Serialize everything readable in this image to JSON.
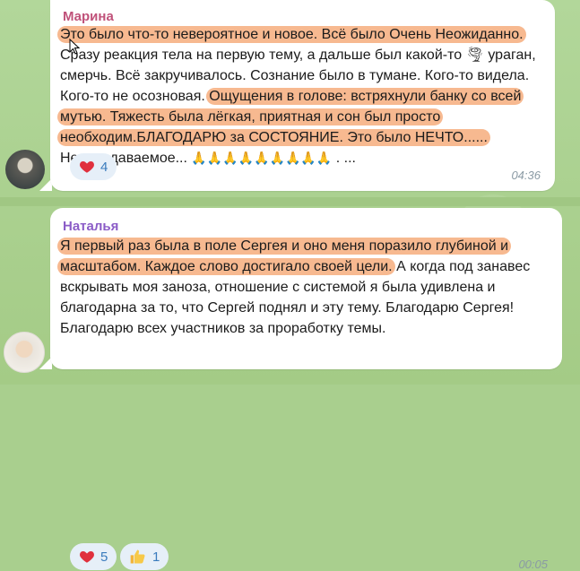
{
  "messages": [
    {
      "sender": "Марина",
      "segments": {
        "s1": "Это было что-то невероятное и новое. Всё было Очень Неожиданно.",
        "s2": " Сразу реакция тела на первую тему, а дальше был  какой-то ",
        "s3": " ураган, смерчь. Всё закручивалось. Сознание было в тумане. Кого-то видела. Кого-то не осозновая. ",
        "s4": "Ощущения в голове: встряхнули банку со всей мутью. Тяжесть была лёгкая, приятная и сон был просто необходим.БЛАГОДАРЮ за СОСТОЯНИЕ. Это было НЕЧТО......",
        "s5": " Непередаваемое... ",
        "s6": "🙏🙏🙏🙏🙏🙏🙏🙏🙏",
        "s7": " . ..."
      },
      "tornado_icon": "tornado-icon",
      "reactions": [
        {
          "emoji": "heart",
          "count": "4"
        }
      ],
      "time": "04:36"
    },
    {
      "sender": "Наталья",
      "segments": {
        "s1": "Я первый раз была в поле Сергея и оно меня поразило глубиной и масштабом. Каждое слово достигало своей цели.",
        "s2": " А когда под занавес вскрывать моя заноза, отношение с системой я была удивлена и благодарна за  то, что Сергей поднял и эту тему. Благодарю Сергея! Благодарю  всех участников за проработку темы."
      },
      "reactions": [
        {
          "emoji": "heart",
          "count": "5"
        },
        {
          "emoji": "thumbs-up",
          "count": "1"
        }
      ],
      "time": "00:05"
    }
  ],
  "colors": {
    "background": "#a9cf8e",
    "highlight": "#f7b990",
    "sender1": "#c0527a",
    "sender2": "#8b5cc7",
    "reaction_bg": "#e6eff8",
    "reaction_text": "#3a7bbd"
  }
}
